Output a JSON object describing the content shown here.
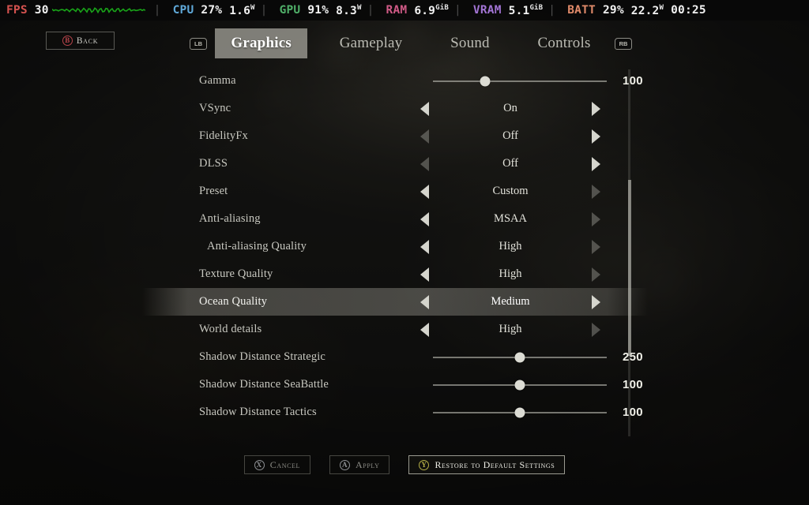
{
  "perf_overlay": {
    "items": [
      {
        "label": "FPS",
        "label_color": "#d4524f",
        "value": "30",
        "unit": "",
        "extra": "",
        "extra_unit": "",
        "graph": true
      },
      {
        "label": "CPU",
        "label_color": "#5fa8d8",
        "value": "27%",
        "unit": "",
        "extra": "1.6",
        "extra_unit": "W",
        "graph": false
      },
      {
        "label": "GPU",
        "label_color": "#4fae68",
        "value": "91%",
        "unit": "",
        "extra": "8.3",
        "extra_unit": "W",
        "graph": false
      },
      {
        "label": "RAM",
        "label_color": "#d05a86",
        "value": "6.9",
        "unit": "GiB",
        "extra": "",
        "extra_unit": "",
        "graph": false
      },
      {
        "label": "VRAM",
        "label_color": "#a274d4",
        "value": "5.1",
        "unit": "GiB",
        "extra": "",
        "extra_unit": "",
        "graph": false
      },
      {
        "label": "BATT",
        "label_color": "#e08a6a",
        "value": "29%",
        "unit": "",
        "extra": "22.2",
        "extra_unit": "W",
        "graph": false
      }
    ],
    "clock": "00:25"
  },
  "header": {
    "back_button": {
      "glyph": "B",
      "label": "Back",
      "glyph_name": "gamepad-b-icon"
    }
  },
  "tabs": {
    "left_bumper": "LB",
    "right_bumper": "RB",
    "items": [
      {
        "label": "Graphics",
        "active": true
      },
      {
        "label": "Gameplay",
        "active": false
      },
      {
        "label": "Sound",
        "active": false
      },
      {
        "label": "Controls",
        "active": false
      }
    ]
  },
  "settings": {
    "rows": [
      {
        "id": "gamma",
        "label": "Gamma",
        "type": "slider",
        "value": "100",
        "percent": 30,
        "indent": false,
        "selected": false
      },
      {
        "id": "vsync",
        "label": "VSync",
        "type": "stepper",
        "value": "On",
        "indent": false,
        "selected": false,
        "left_dim": false,
        "right_dim": false
      },
      {
        "id": "fidelityfx",
        "label": "FidelityFx",
        "type": "stepper",
        "value": "Off",
        "indent": false,
        "selected": false,
        "left_dim": true,
        "right_dim": false
      },
      {
        "id": "dlss",
        "label": "DLSS",
        "type": "stepper",
        "value": "Off",
        "indent": false,
        "selected": false,
        "left_dim": true,
        "right_dim": false
      },
      {
        "id": "preset",
        "label": "Preset",
        "type": "stepper",
        "value": "Custom",
        "indent": false,
        "selected": false,
        "left_dim": false,
        "right_dim": true
      },
      {
        "id": "anti-aliasing",
        "label": "Anti-aliasing",
        "type": "stepper",
        "value": "MSAA",
        "indent": false,
        "selected": false,
        "left_dim": false,
        "right_dim": true
      },
      {
        "id": "anti-aliasing-quality",
        "label": "Anti-aliasing Quality",
        "type": "stepper",
        "value": "High",
        "indent": true,
        "selected": false,
        "left_dim": false,
        "right_dim": true
      },
      {
        "id": "texture-quality",
        "label": "Texture Quality",
        "type": "stepper",
        "value": "High",
        "indent": false,
        "selected": false,
        "left_dim": false,
        "right_dim": true
      },
      {
        "id": "ocean-quality",
        "label": "Ocean Quality",
        "type": "stepper",
        "value": "Medium",
        "indent": false,
        "selected": true,
        "left_dim": false,
        "right_dim": false
      },
      {
        "id": "world-details",
        "label": "World details",
        "type": "stepper",
        "value": "High",
        "indent": false,
        "selected": false,
        "left_dim": false,
        "right_dim": true
      },
      {
        "id": "shadow-distance-strategic",
        "label": "Shadow Distance Strategic",
        "type": "slider",
        "value": "250",
        "percent": 50,
        "indent": false,
        "selected": false
      },
      {
        "id": "shadow-distance-seabattle",
        "label": "Shadow Distance SeaBattle",
        "type": "slider",
        "value": "100",
        "percent": 50,
        "indent": false,
        "selected": false
      },
      {
        "id": "shadow-distance-tactics",
        "label": "Shadow Distance Tactics",
        "type": "slider",
        "value": "100",
        "percent": 50,
        "indent": false,
        "selected": false
      }
    ]
  },
  "scrollbar": {
    "thumb_top_pct": 30,
    "thumb_height_pct": 48
  },
  "footer": {
    "buttons": [
      {
        "id": "cancel",
        "glyph": "X",
        "glyph_name": "gamepad-x-icon",
        "label": "Cancel",
        "primary": false
      },
      {
        "id": "apply",
        "glyph": "A",
        "glyph_name": "gamepad-a-icon",
        "label": "Apply",
        "primary": false
      },
      {
        "id": "restore",
        "glyph": "Y",
        "glyph_name": "gamepad-y-icon",
        "label": "Restore to Default Settings",
        "primary": true
      }
    ]
  }
}
